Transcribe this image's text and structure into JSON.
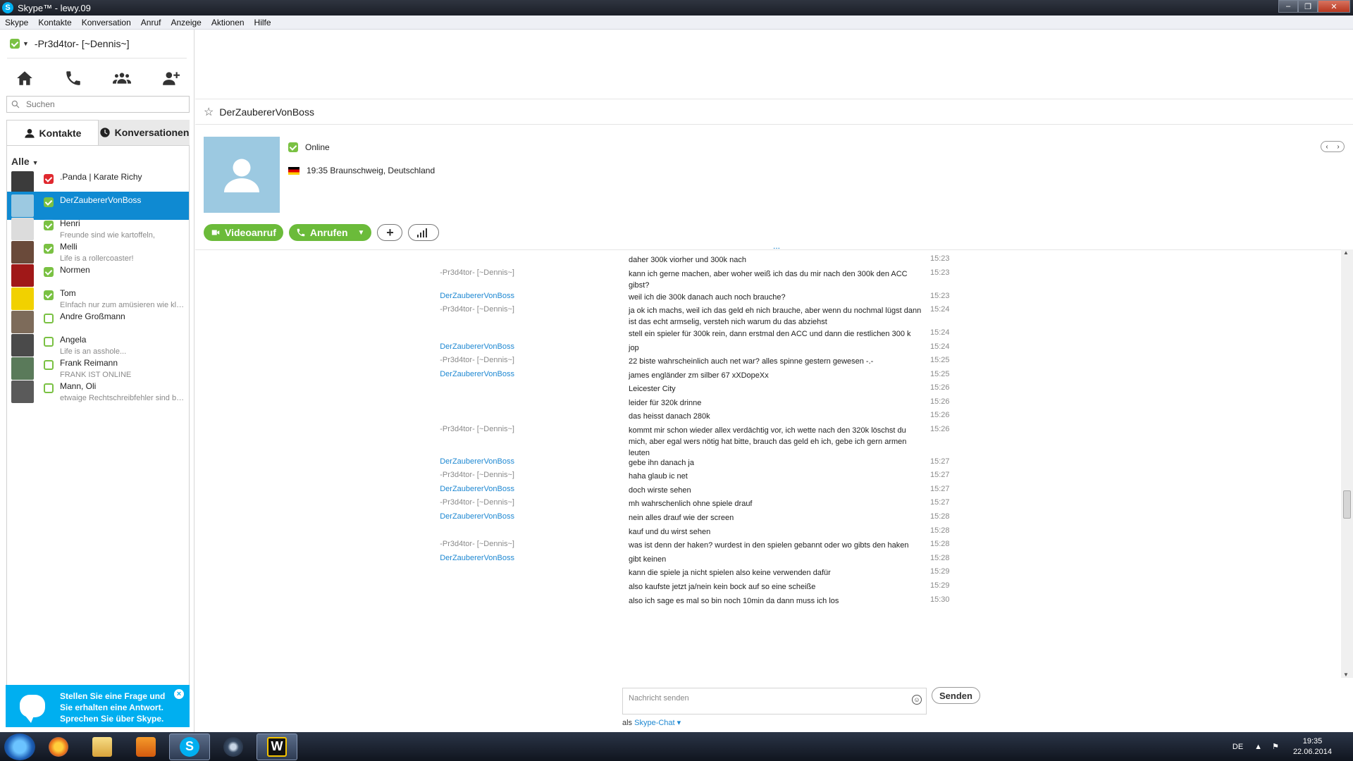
{
  "window": {
    "title": "Skype™ - lewy.09",
    "logo_letter": "S"
  },
  "menu": [
    "Skype",
    "Kontakte",
    "Konversation",
    "Anruf",
    "Anzeige",
    "Aktionen",
    "Hilfe"
  ],
  "user": {
    "name": "-Pr3d4tor- [~Dennis~]"
  },
  "search": {
    "placeholder": "Suchen"
  },
  "tabs": {
    "contacts": "Kontakte",
    "conversations": "Konversationen"
  },
  "filter": "Alle",
  "contacts": [
    {
      "name": ".Panda | Karate Richy",
      "mood": "",
      "status": "busy",
      "avatar_color": "#3b3b3b"
    },
    {
      "name": "DerZaubererVonBoss",
      "mood": "",
      "status": "online",
      "avatar_color": "#9cc9e1"
    },
    {
      "name": "Henri",
      "mood": "Freunde sind wie kartoffeln,",
      "status": "online",
      "avatar_color": "#dcdcdc"
    },
    {
      "name": "Melli",
      "mood": "Life is a rollercoaster!",
      "status": "online",
      "avatar_color": "#6a4a3a"
    },
    {
      "name": "Normen",
      "mood": "",
      "status": "online",
      "avatar_color": "#a01818"
    },
    {
      "name": "Tom",
      "mood": "EInfach nur zum amüsieren wie klei...",
      "status": "online",
      "avatar_color": "#f1d100"
    },
    {
      "name": "Andre Großmann",
      "mood": "",
      "status": "offline",
      "avatar_color": "#7d6b5a"
    },
    {
      "name": "Angela",
      "mood": "Life is an asshole...",
      "status": "offline",
      "avatar_color": "#4a4a4a"
    },
    {
      "name": "Frank Reimann",
      "mood": "FRANK IST ONLINE",
      "status": "offline",
      "avatar_color": "#5a7a5a"
    },
    {
      "name": "Mann, Oli",
      "mood": "etwaige Rechtschreibfehler sind be...",
      "status": "offline",
      "avatar_color": "#5a5a5a"
    }
  ],
  "ad": {
    "text": "Stellen Sie eine Frage und Sie erhalten eine Antwort. Sprechen Sie über Skype.",
    "close": "×"
  },
  "conversation": {
    "title": "DerZaubererVonBoss",
    "status": "Online",
    "location": "19:35 Braunschweig, Deutschland",
    "video_label": "Videoanruf",
    "call_label": "Anrufen",
    "more_dots": "...",
    "compose_placeholder": "Nachricht senden",
    "send_label": "Senden",
    "as_prefix": "als",
    "as_link": "Skype-Chat"
  },
  "messages": [
    {
      "author": "",
      "text": "daher 300k viorher und 300k nach",
      "time": "15:23",
      "who": ""
    },
    {
      "author": "-Pr3d4tor- [~Dennis~]",
      "text": "kann ich gerne machen, aber woher weiß ich das du mir nach den 300k den ACC gibst?",
      "time": "15:23",
      "who": "me"
    },
    {
      "author": "DerZaubererVonBoss",
      "text": "weil ich die 300k danach auch noch brauche?",
      "time": "15:23",
      "who": "other"
    },
    {
      "author": "-Pr3d4tor- [~Dennis~]",
      "text": "ja ok ich machs, weil ich das geld eh nich brauche, aber wenn du nochmal lügst dann ist das echt armselig, versteh nich warum du das abziehst",
      "time": "15:24",
      "who": "me"
    },
    {
      "author": "",
      "text": "stell ein spieler für 300k rein, dann erstmal den ACC und dann die restlichen 300 k",
      "time": "15:24",
      "who": ""
    },
    {
      "author": "DerZaubererVonBoss",
      "text": "jop",
      "time": "15:24",
      "who": "other"
    },
    {
      "author": "-Pr3d4tor- [~Dennis~]",
      "text": "22 biste wahrscheinlich auch net war? alles spinne gestern gewesen -.-",
      "time": "15:25",
      "who": "me"
    },
    {
      "author": "DerZaubererVonBoss",
      "text": "james engländer zm silber 67 xXDopeXx",
      "time": "15:25",
      "who": "other"
    },
    {
      "author": "",
      "text": "Leicester City",
      "time": "15:26",
      "who": ""
    },
    {
      "author": "",
      "text": "leider für 320k drinne",
      "time": "15:26",
      "who": ""
    },
    {
      "author": "",
      "text": "das heisst danach 280k",
      "time": "15:26",
      "who": ""
    },
    {
      "author": "-Pr3d4tor- [~Dennis~]",
      "text": "kommt mir schon wieder allex verdächtig vor, ich wette nach den 320k löschst du mich, aber egal wers nötig hat bitte, brauch das geld eh ich, gebe ich gern armen leuten",
      "time": "15:26",
      "who": "me"
    },
    {
      "author": "DerZaubererVonBoss",
      "text": "gebe ihn danach ja",
      "time": "15:27",
      "who": "other"
    },
    {
      "author": "-Pr3d4tor- [~Dennis~]",
      "text": "haha glaub ic net",
      "time": "15:27",
      "who": "me"
    },
    {
      "author": "DerZaubererVonBoss",
      "text": "doch wirste sehen",
      "time": "15:27",
      "who": "other"
    },
    {
      "author": "-Pr3d4tor- [~Dennis~]",
      "text": "mh wahrschenlich ohne spiele drauf",
      "time": "15:27",
      "who": "me"
    },
    {
      "author": "DerZaubererVonBoss",
      "text": "nein alles drauf wie der screen",
      "time": "15:28",
      "who": "other"
    },
    {
      "author": "",
      "text": "kauf und du wirst sehen",
      "time": "15:28",
      "who": ""
    },
    {
      "author": "-Pr3d4tor- [~Dennis~]",
      "text": "was ist denn der haken? wurdest in den spielen gebannt oder wo gibts den haken",
      "time": "15:28",
      "who": "me"
    },
    {
      "author": "DerZaubererVonBoss",
      "text": "gibt keinen",
      "time": "15:28",
      "who": "other"
    },
    {
      "author": "",
      "text": "kann die spiele ja nicht spielen also keine verwenden dafür",
      "time": "15:29",
      "who": ""
    },
    {
      "author": "",
      "text": "also kaufste jetzt ja/nein kein bock auf so eine scheiße",
      "time": "15:29",
      "who": ""
    },
    {
      "author": "",
      "text": "also ich sage es mal so bin noch 10min da dann muss ich los",
      "time": "15:30",
      "who": ""
    }
  ],
  "taskbar": {
    "lang": "DE",
    "time": "19:35",
    "date": "22.06.2014"
  }
}
